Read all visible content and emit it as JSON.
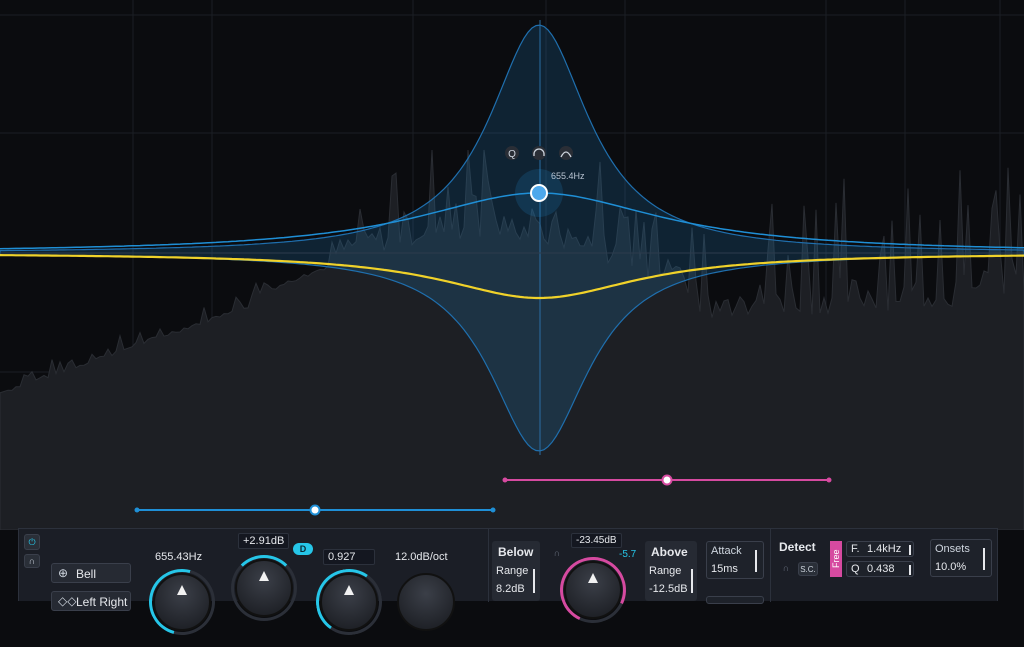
{
  "band": {
    "frequency_tooltip": "655.4Hz",
    "handle_icons": [
      "zoom-icon",
      "headphones-icon",
      "bell-shape-icon"
    ]
  },
  "colors": {
    "background": "#0b0c0f",
    "eq_blue": "#1f8fd6",
    "eq_curve_yellow": "#f0d22a",
    "range_pink": "#d64aa0",
    "accent_cyan": "#26c6e8"
  },
  "panel": {
    "shape_label": "Bell",
    "stereo_label": "Left Right",
    "frequency": "655.43Hz",
    "gain": "+2.91dB",
    "dynamic_badge": "D",
    "q": "0.927",
    "slope": "12.0dB/oct",
    "below": {
      "title": "Below",
      "range_label": "Range",
      "range_value": "8.2dB"
    },
    "threshold": "-23.45dB",
    "threshold_side": "-5.7",
    "above": {
      "title": "Above",
      "range_label": "Range",
      "range_value": "-12.5dB"
    },
    "attack": {
      "label": "Attack",
      "value": "15ms"
    },
    "detect": {
      "title": "Detect",
      "sc_label": "S.C.",
      "free_label": "Free",
      "f_label": "F.",
      "f_value": "1.4kHz",
      "q_label": "Q",
      "q_value": "0.438"
    },
    "onsets": {
      "label": "Onsets",
      "value": "10.0%"
    }
  }
}
